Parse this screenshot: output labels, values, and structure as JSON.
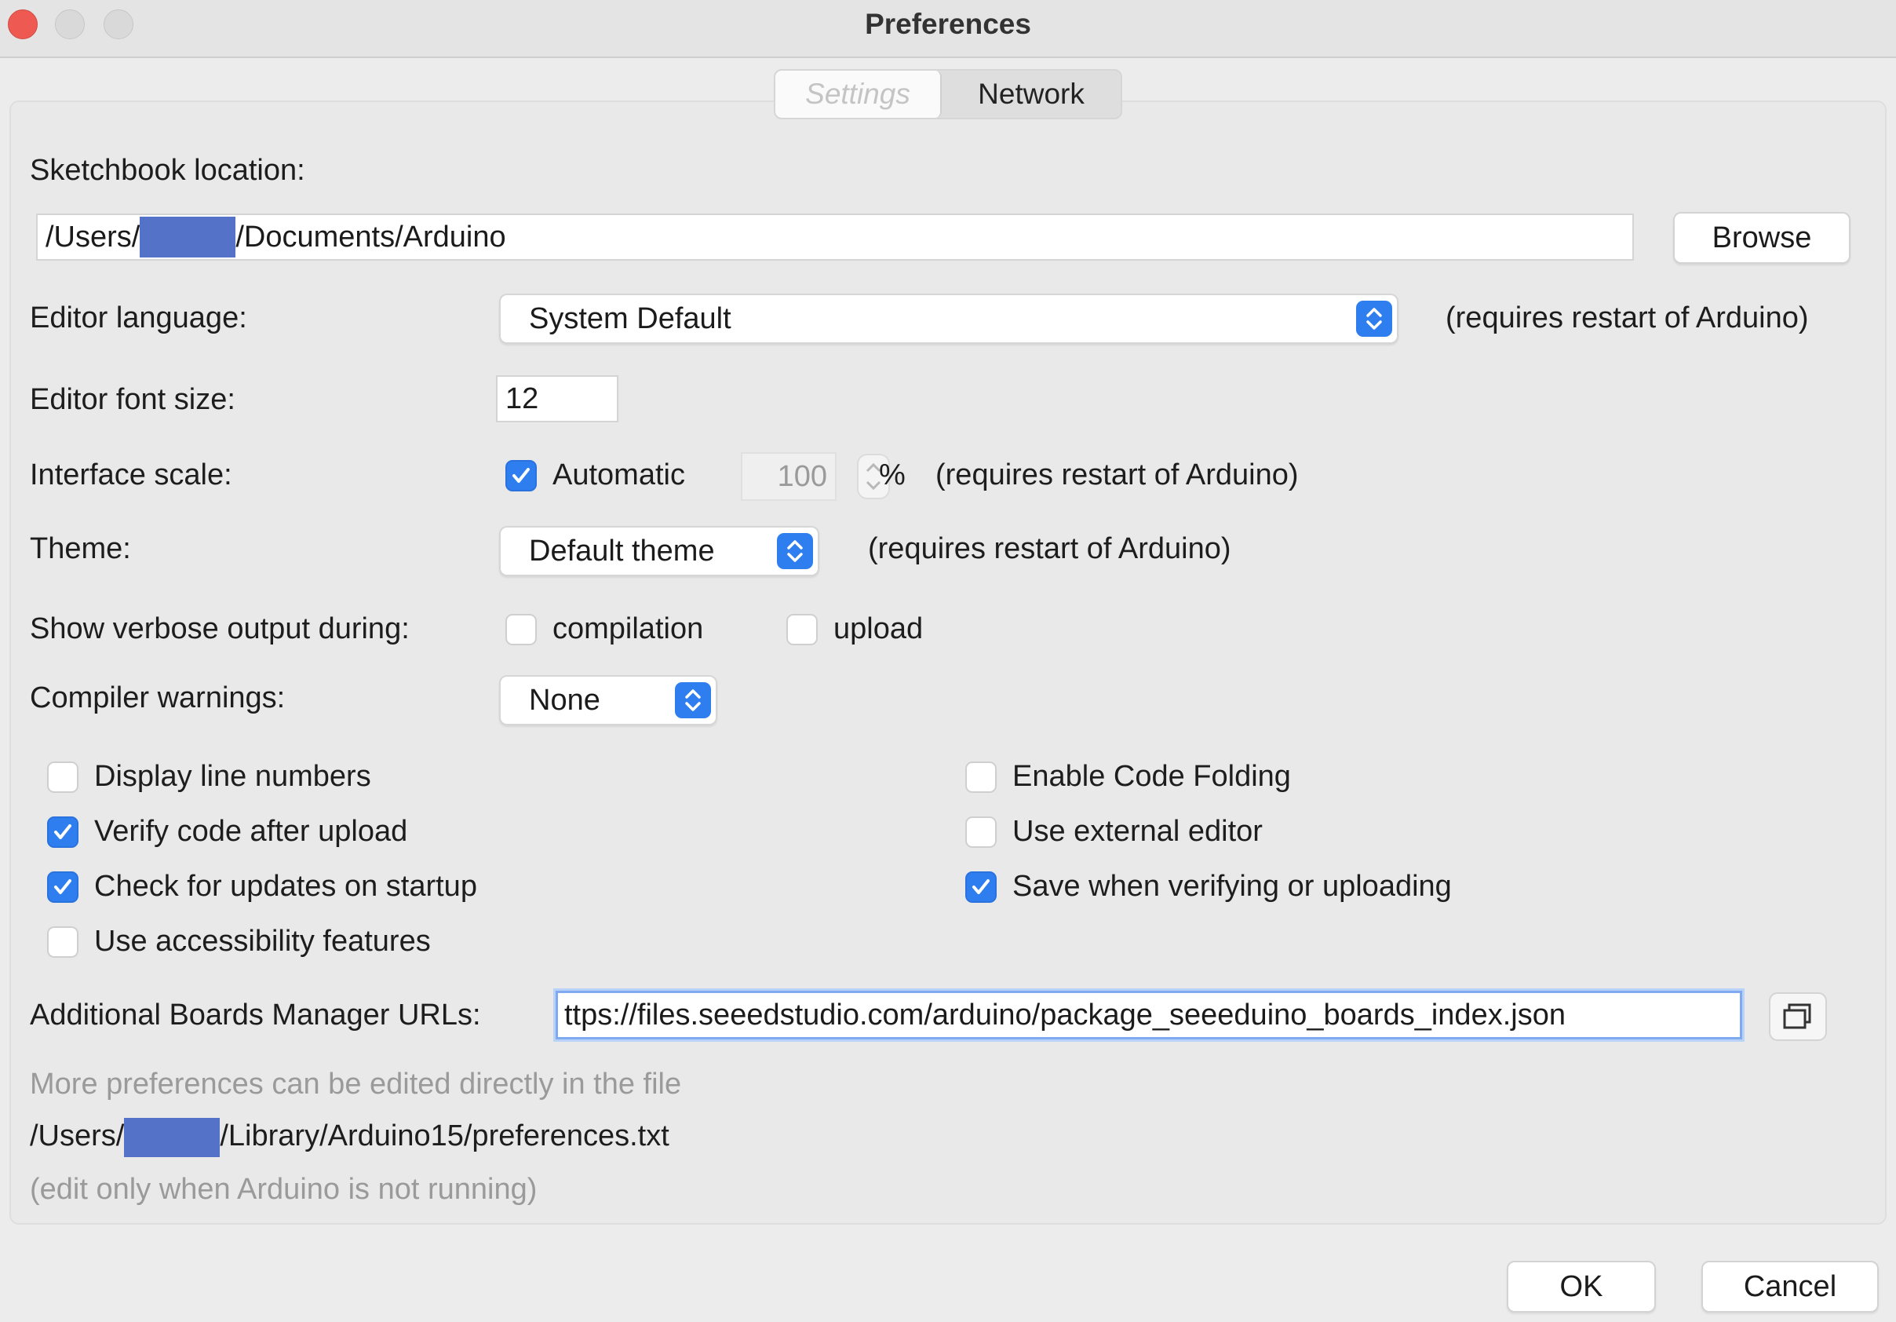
{
  "window": {
    "title": "Preferences"
  },
  "tabs": {
    "settings": "Settings",
    "network": "Network"
  },
  "sketchbook": {
    "label": "Sketchbook location:",
    "path_prefix": "/Users/",
    "path_suffix": "/Documents/Arduino",
    "browse_label": "Browse"
  },
  "editor_language": {
    "label": "Editor language:",
    "value": "System Default",
    "note": "(requires restart of Arduino)"
  },
  "editor_font_size": {
    "label": "Editor font size:",
    "value": "12"
  },
  "interface_scale": {
    "label": "Interface scale:",
    "automatic_label": "Automatic",
    "automatic_checked": true,
    "value": "100",
    "unit": "%",
    "note": "(requires restart of Arduino)"
  },
  "theme": {
    "label": "Theme:",
    "value": "Default theme",
    "note": "(requires restart of Arduino)"
  },
  "verbose": {
    "label": "Show verbose output during:",
    "compilation_label": "compilation",
    "compilation_checked": false,
    "upload_label": "upload",
    "upload_checked": false
  },
  "compiler_warnings": {
    "label": "Compiler warnings:",
    "value": "None"
  },
  "options": {
    "display_line_numbers": {
      "label": "Display line numbers",
      "checked": false
    },
    "verify_after_upload": {
      "label": "Verify code after upload",
      "checked": true
    },
    "check_updates": {
      "label": "Check for updates on startup",
      "checked": true
    },
    "accessibility": {
      "label": "Use accessibility features",
      "checked": false
    },
    "code_folding": {
      "label": "Enable Code Folding",
      "checked": false
    },
    "external_editor": {
      "label": "Use external editor",
      "checked": false
    },
    "save_on_verify": {
      "label": "Save when verifying or uploading",
      "checked": true
    }
  },
  "boards_manager": {
    "label": "Additional Boards Manager URLs:",
    "value": "ttps://files.seeedstudio.com/arduino/package_seeeduino_boards_index.json"
  },
  "footer": {
    "more_prefs": "More preferences can be edited directly in the file",
    "prefs_path_prefix": "/Users/",
    "prefs_path_suffix": "/Library/Arduino15/preferences.txt",
    "edit_note": "(edit only when Arduino is not running)"
  },
  "buttons": {
    "ok": "OK",
    "cancel": "Cancel"
  },
  "colors": {
    "accent": "#2f7ef0",
    "redaction": "#5572c9",
    "close": "#ee5a52"
  }
}
